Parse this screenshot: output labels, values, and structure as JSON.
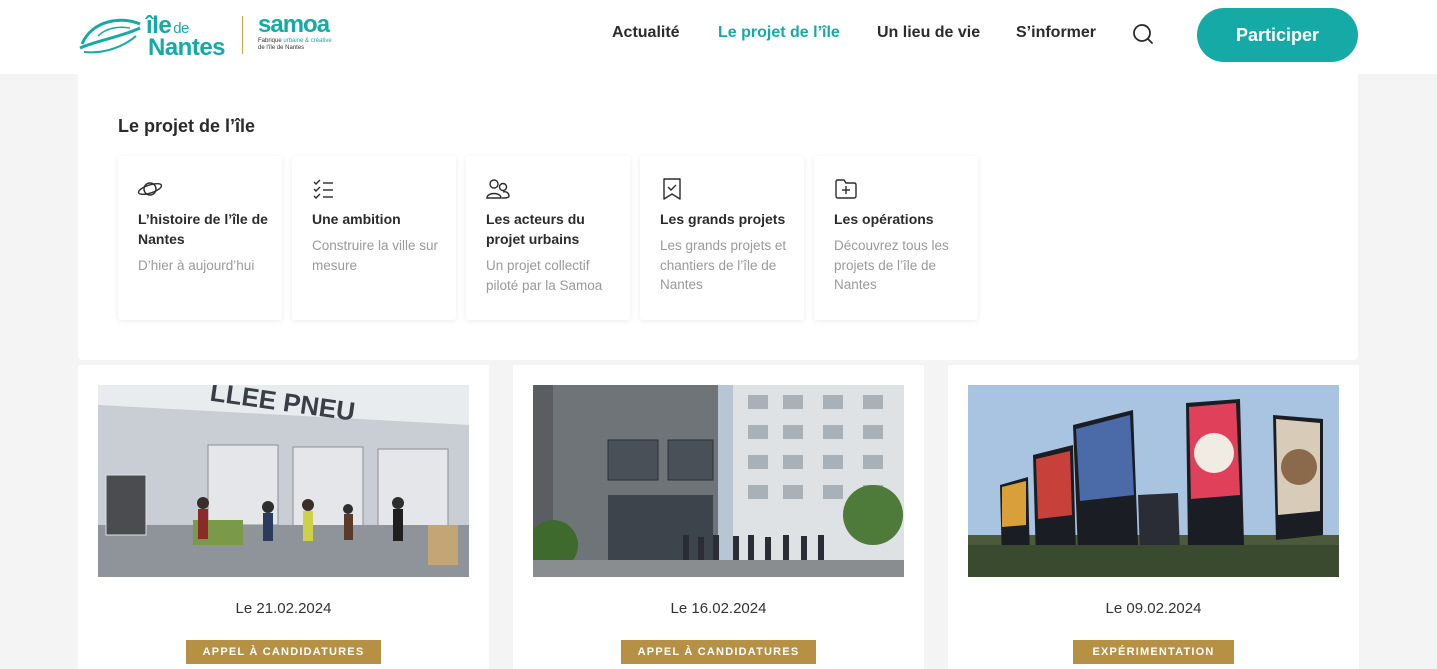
{
  "header": {
    "logo_ile": {
      "line1": "île",
      "line1_small": "de",
      "line2": "Nantes"
    },
    "logo_samoa": {
      "name": "samoa",
      "tagline_a": "Fabrique",
      "tagline_b": "urbaine & créative",
      "tagline_c": "de l'île de Nantes"
    },
    "nav": [
      {
        "label": "Actualité"
      },
      {
        "label": "Le projet de l’île"
      },
      {
        "label": "Un lieu de vie"
      },
      {
        "label": "S’informer"
      }
    ],
    "cta_label": "Participer"
  },
  "mega_menu": {
    "title": "Le projet de l’île",
    "cards": [
      {
        "icon": "planet-icon",
        "title": "L’histoire de l’île de Nantes",
        "subtitle": "D’hier à aujourd’hui"
      },
      {
        "icon": "checklist-icon",
        "title": "Une ambition",
        "subtitle": "Construire la ville sur mesure"
      },
      {
        "icon": "users-icon",
        "title": "Les acteurs du projet urbains",
        "subtitle": "Un projet collectif piloté par la Samoa"
      },
      {
        "icon": "bookmark-check-icon",
        "title": "Les grands projets",
        "subtitle": "Les grands projets et chantiers de l’île de Nantes"
      },
      {
        "icon": "folder-plus-icon",
        "title": "Les opérations",
        "subtitle": "Découvrez tous les projets de l’île de Nantes"
      }
    ]
  },
  "articles": [
    {
      "date": "Le 21.02.2024",
      "tag": "APPEL À CANDIDATURES",
      "image": "market-hall-photo"
    },
    {
      "date": "Le 16.02.2024",
      "tag": "APPEL À CANDIDATURES",
      "image": "buildings-photo"
    },
    {
      "date": "Le 09.02.2024",
      "tag": "EXPÉRIMENTATION",
      "image": "art-panels-photo"
    }
  ],
  "colors": {
    "accent": "#16aaa7",
    "tag": "#b69143",
    "navy": "#1d2a4a"
  }
}
